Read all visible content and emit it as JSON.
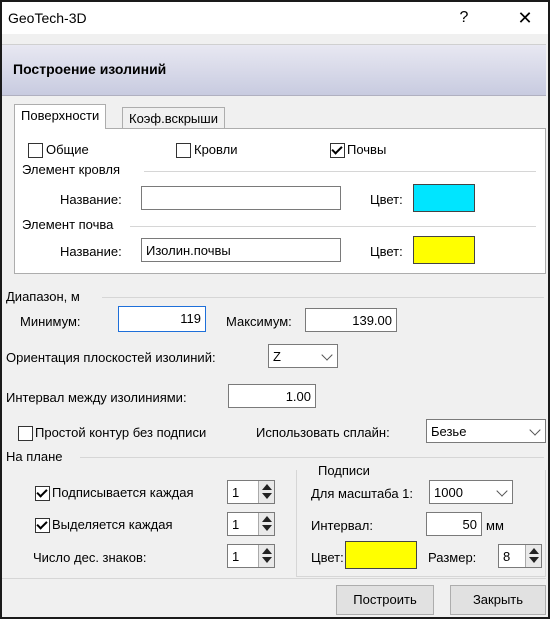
{
  "window": {
    "title": "GeoTech-3D",
    "help_glyph": "?",
    "close_glyph": "✕"
  },
  "header": {
    "title": "Построение изолиний"
  },
  "tabs": [
    {
      "label": "Поверхности",
      "active": true
    },
    {
      "label": "Коэф.вскрыши",
      "active": false
    }
  ],
  "surfaces": {
    "checks": [
      {
        "label": "Общие",
        "checked": false
      },
      {
        "label": "Кровли",
        "checked": false
      },
      {
        "label": "Почвы",
        "checked": true
      }
    ],
    "roof": {
      "group": "Элемент кровля",
      "name_label": "Название:",
      "name_value": "",
      "color_label": "Цвет:",
      "color": "#00e5ff"
    },
    "soil": {
      "group": "Элемент почва",
      "name_label": "Название:",
      "name_value": "Изолин.почвы",
      "color_label": "Цвет:",
      "color": "#ffff00"
    }
  },
  "range": {
    "group": "Диапазон, м",
    "min_label": "Минимум:",
    "min_value": "119",
    "max_label": "Максимум:",
    "max_value": "139.00"
  },
  "orientation": {
    "label": "Ориентация плоскостей изолиний:",
    "value": "Z"
  },
  "interval": {
    "label": "Интервал между изолиниями:",
    "value": "1.00"
  },
  "contour": {
    "label": "Простой контур без подписи",
    "checked": false,
    "spline_label": "Использовать сплайн:",
    "spline_value": "Безье"
  },
  "plan": {
    "group": "На плане",
    "label_each": {
      "label": "Подписывается каждая",
      "checked": true,
      "value": "1"
    },
    "highlight_each": {
      "label": "Выделяется каждая",
      "checked": true,
      "value": "1"
    },
    "decimals": {
      "label": "Число дес. знаков:",
      "value": "1"
    }
  },
  "captions": {
    "group": "Подписи",
    "scale_label": "Для масштаба 1:",
    "scale_value": "1000",
    "interval_label": "Интервал:",
    "interval_value": "50",
    "interval_unit": "мм",
    "color_label": "Цвет:",
    "color": "#ffff00",
    "size_label": "Размер:",
    "size_value": "8"
  },
  "buttons": {
    "build": "Построить",
    "close": "Закрыть"
  }
}
